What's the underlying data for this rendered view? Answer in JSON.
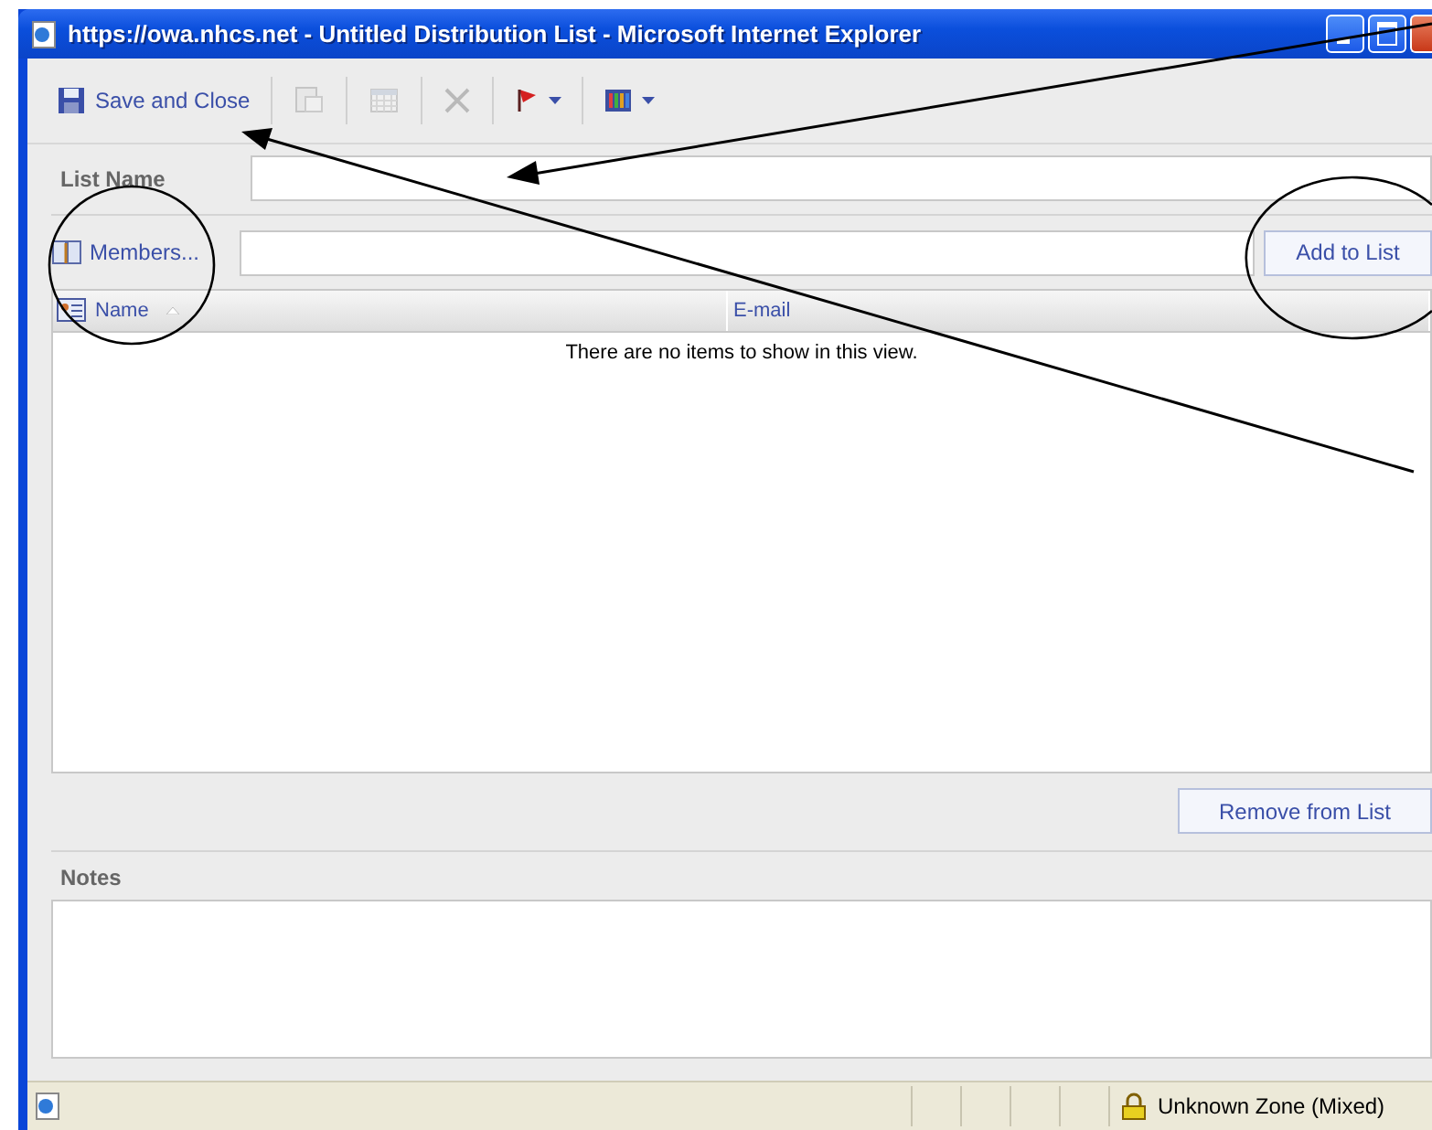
{
  "window": {
    "title": "https://owa.nhcs.net - Untitled Distribution List - Microsoft Internet Explorer"
  },
  "toolbar": [
    {
      "kind": "labeled",
      "label": "Save and Close",
      "disabled": false
    },
    {
      "kind": "plain",
      "disabled": true
    },
    {
      "kind": "plain",
      "disabled": true
    },
    {
      "kind": "plain",
      "disabled": true
    },
    {
      "kind": "dropdown",
      "disabled": false
    },
    {
      "kind": "dropdown",
      "disabled": false
    }
  ],
  "list_name": {
    "label": "List Name"
  },
  "members": {
    "button": "Members...",
    "add_button": "Add to List"
  },
  "table": {
    "columns": [
      {
        "label": "Name",
        "sorted": true
      },
      {
        "label": "E-mail",
        "sorted": false
      }
    ],
    "empty_message": "There are no items to show in this view."
  },
  "remove_button": "Remove from List",
  "notes": {
    "label": "Notes"
  },
  "status_bar": {
    "zone": "Unknown Zone (Mixed)"
  }
}
